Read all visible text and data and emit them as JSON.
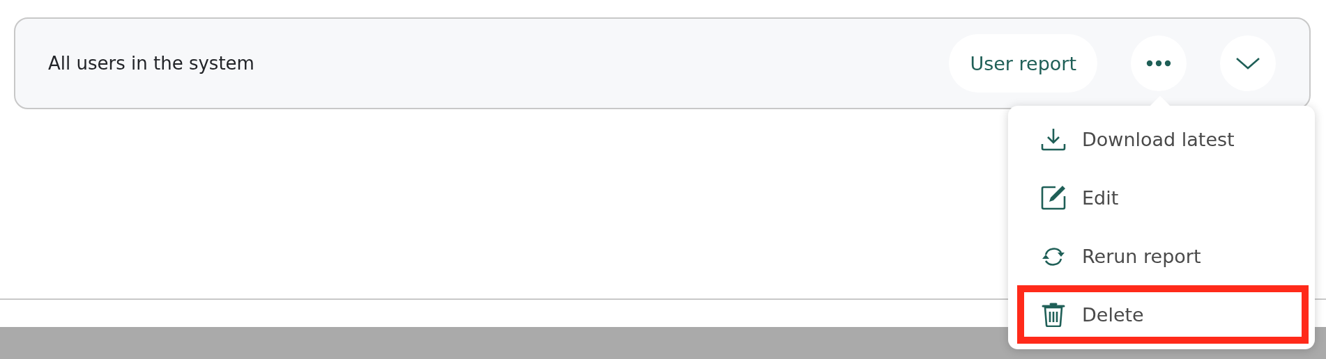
{
  "report_card": {
    "title": "All users in the system",
    "tag": "User report",
    "expanded": false
  },
  "menu": {
    "open": true,
    "items": [
      {
        "kind": "download",
        "label": "Download latest",
        "highlighted": false
      },
      {
        "kind": "edit",
        "label": "Edit",
        "highlighted": false
      },
      {
        "kind": "rerun",
        "label": "Rerun report",
        "highlighted": false
      },
      {
        "kind": "delete",
        "label": "Delete",
        "highlighted": true
      }
    ]
  }
}
